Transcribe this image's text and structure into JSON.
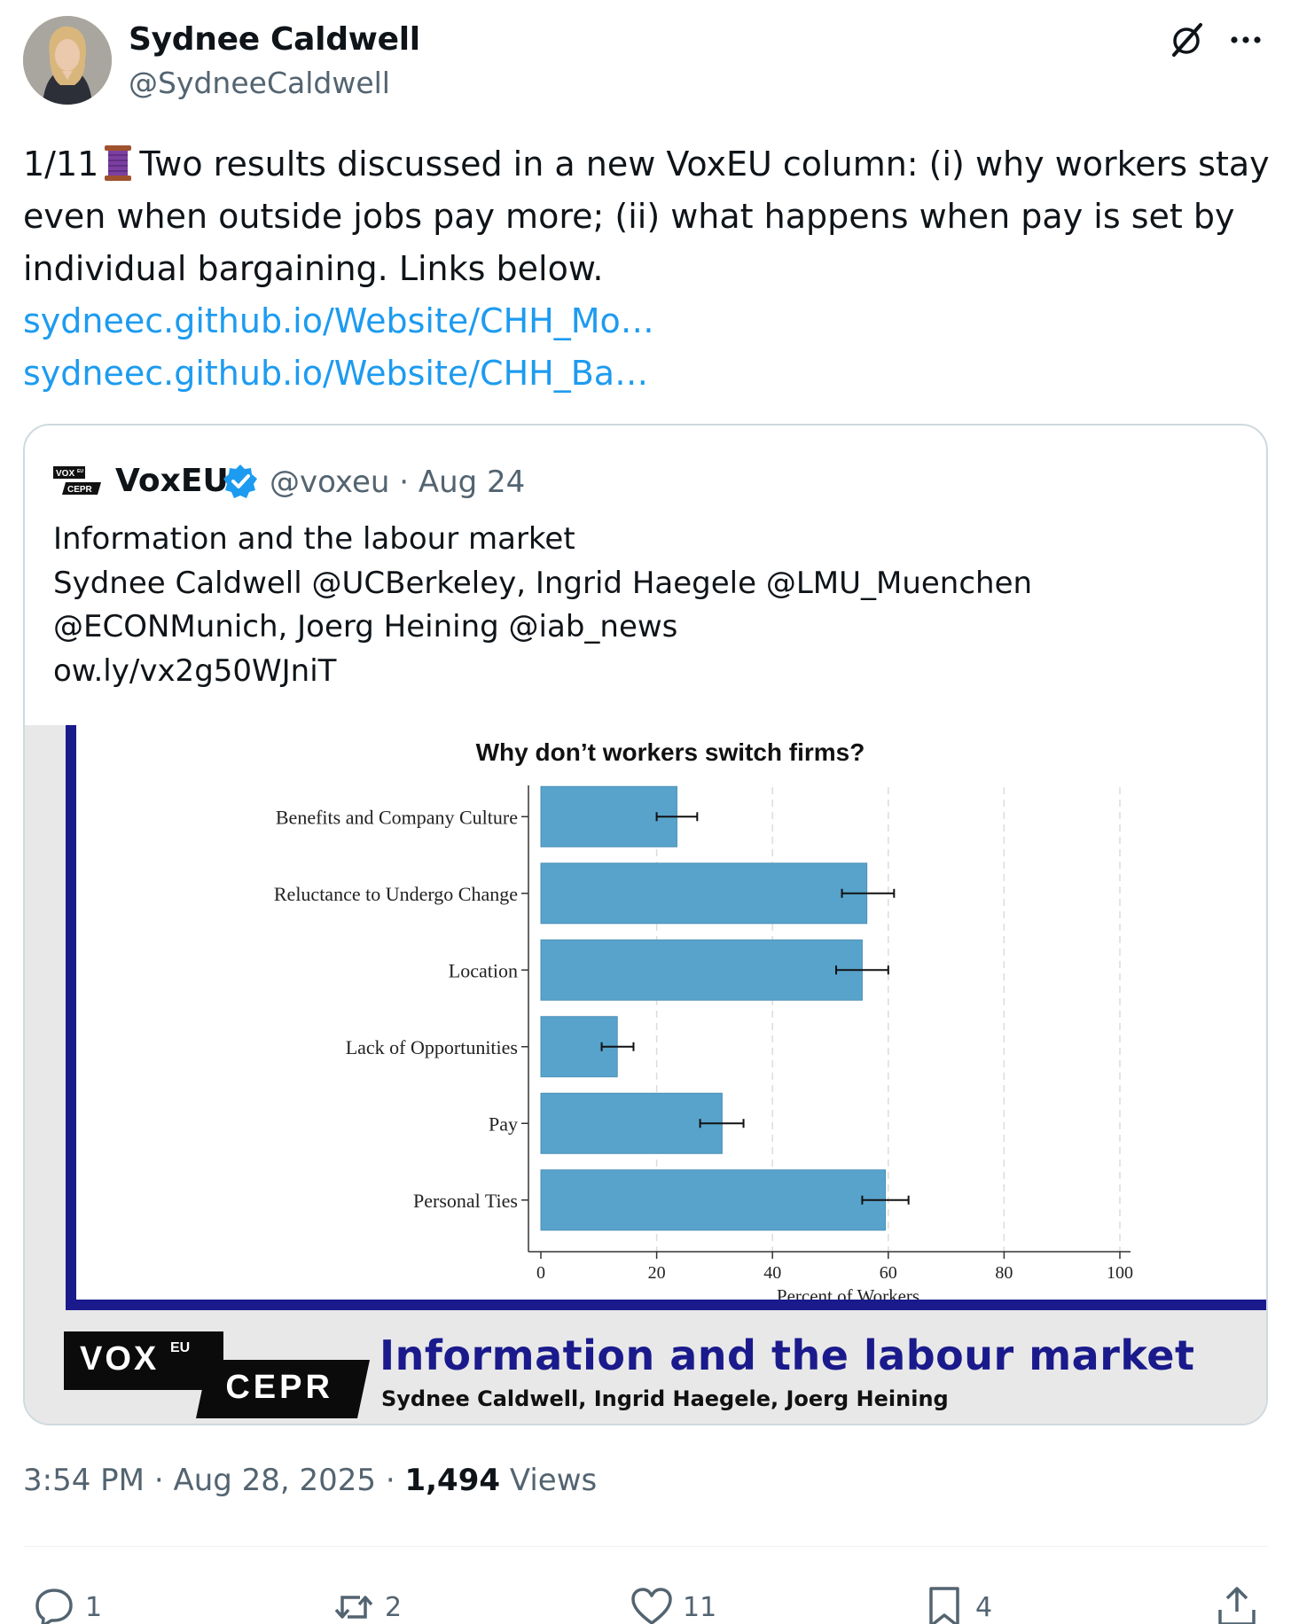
{
  "author": {
    "name": "Sydnee Caldwell",
    "handle": "@SydneeCaldwell"
  },
  "tweet": {
    "prefix": "1/11",
    "body": "Two results discussed in a new VoxEU column: (i) why workers stay even when outside jobs pay more; (ii) what happens when pay is set by individual bargaining. Links below.",
    "links": [
      "sydneec.github.io/Website/CHH_Mo…",
      "sydneec.github.io/Website/CHH_Ba…"
    ]
  },
  "quote": {
    "name": "VoxEU",
    "handle_date": "@voxeu · Aug 24",
    "lines": [
      "Information and the labour market",
      "Sydnee Caldwell @UCBerkeley, Ingrid Haegele @LMU_Muenchen",
      "@ECONMunich, Joerg Heining @iab_news",
      "ow.ly/vx2g50WJniT"
    ],
    "logo_text_top": "VOX",
    "logo_text_sup": "EU",
    "logo_text_bottom": "CEPR",
    "banner": {
      "vox": "VOX",
      "eu": "EU",
      "cepr": "CEPR",
      "title": "Information and the labour market",
      "authors": "Sydnee Caldwell, Ingrid Haegele, Joerg Heining"
    }
  },
  "chart_data": {
    "type": "bar",
    "orientation": "horizontal",
    "title": "Why don’t workers switch firms?",
    "xlabel": "Percent of Workers",
    "ylabel": "",
    "xlim": [
      0,
      100
    ],
    "xticks": [
      "0",
      "20",
      "40",
      "60",
      "80",
      "100"
    ],
    "grid": "vertical dashed",
    "categories": [
      "Benefits and Company Culture",
      "Reluctance to Undergo Change",
      "Location",
      "Lack of Opportunities",
      "Pay",
      "Personal Ties"
    ],
    "values": [
      23.5,
      56.3,
      55.5,
      13.2,
      31.3,
      59.5
    ],
    "error_low": [
      20.0,
      52.0,
      51.0,
      10.5,
      27.5,
      55.5
    ],
    "error_high": [
      27.0,
      61.0,
      60.0,
      16.0,
      35.0,
      63.5
    ],
    "bar_color": "#57a3cb"
  },
  "meta": {
    "time": "3:54 PM",
    "date": "Aug 28, 2025",
    "views_count": "1,494",
    "views_label": "Views"
  },
  "actions": {
    "replies": "1",
    "reposts": "2",
    "likes": "11",
    "bookmarks": "4"
  },
  "icons": {
    "grok": "grok-icon",
    "more": "more-icon",
    "thread": "thread-spool-icon",
    "verified": "verified-badge-icon",
    "reply": "reply-icon",
    "repost": "repost-icon",
    "like": "heart-icon",
    "bookmark": "bookmark-icon",
    "share": "share-icon"
  },
  "colors": {
    "link": "#1d9bf0",
    "secondary_text": "#536471",
    "verified": "#1d9bf0",
    "banner_accent": "#1a1a8c"
  }
}
